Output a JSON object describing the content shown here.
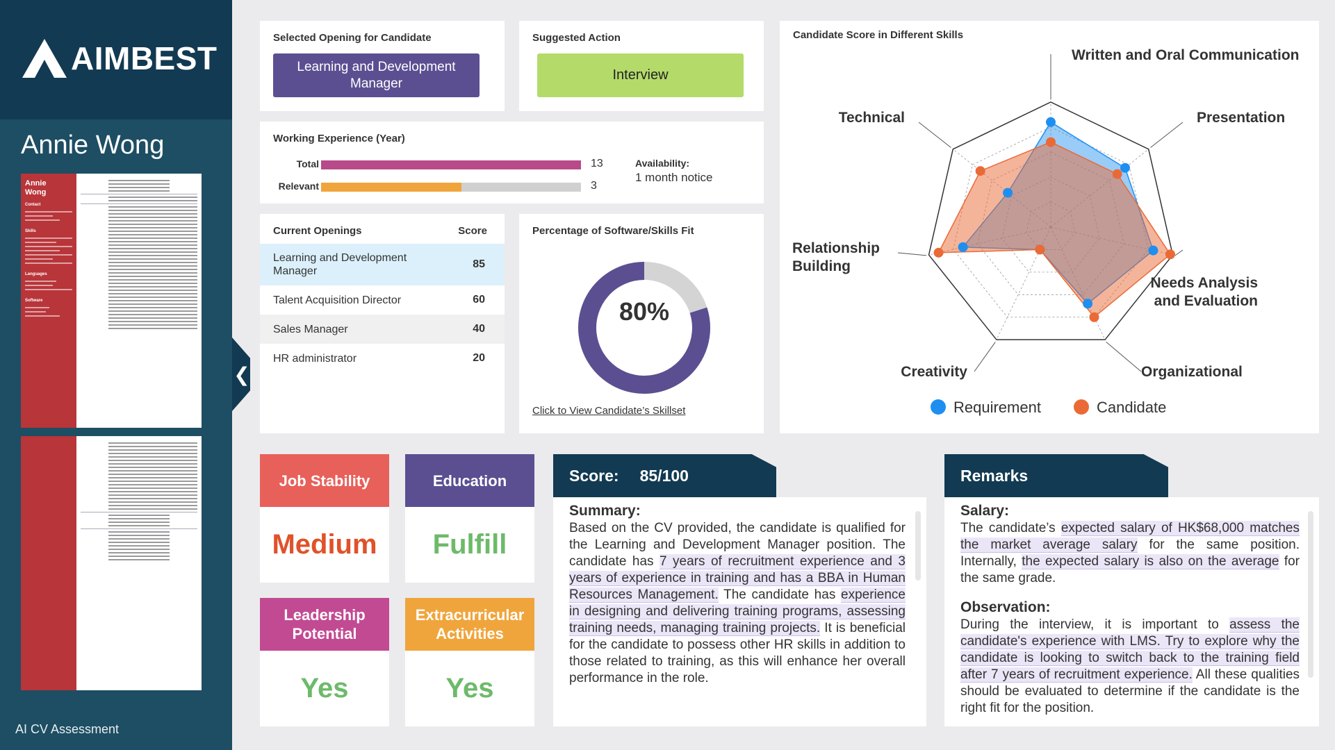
{
  "app": {
    "logo_text": "AIMBEST",
    "candidate_name": "Annie Wong",
    "footer_label": "AI CV Assessment",
    "collapse_glyph": "❮",
    "cv_thumbnail": {
      "name_line1": "Annie",
      "name_line2": "Wong",
      "side_sections": [
        "Contact",
        "Skills",
        "Languages",
        "Software"
      ]
    }
  },
  "selected_opening": {
    "title": "Selected Opening for Candidate",
    "value": "Learning and Development Manager"
  },
  "suggested_action": {
    "title": "Suggested Action",
    "value": "Interview"
  },
  "working_experience": {
    "title": "Working Experience (Year)",
    "rows": [
      {
        "label": "Total",
        "value": "13",
        "fraction": 1.0,
        "color": "#b84a8a"
      },
      {
        "label": "Relevant",
        "value": "3",
        "fraction": 0.54,
        "color": "#f0a53c"
      }
    ],
    "availability_label": "Availability:",
    "availability_value": "1 month notice"
  },
  "current_openings": {
    "title": "Current Openings",
    "score_header": "Score",
    "rows": [
      {
        "name": "Learning and Development Manager",
        "score": "85",
        "selected": true
      },
      {
        "name": "Talent Acquisition Director",
        "score": "60",
        "selected": false
      },
      {
        "name": "Sales Manager",
        "score": "40",
        "selected": false
      },
      {
        "name": "HR administrator",
        "score": "20",
        "selected": false
      }
    ]
  },
  "skills_fit": {
    "title": "Percentage of Software/Skills Fit",
    "percent_label": "80%",
    "fraction": 0.8,
    "fill_color": "#5b4f92",
    "rest_color": "#d4d4d4",
    "link_text": "Click to View Candidate’s Skillset"
  },
  "radar": {
    "title": "Candidate Score in Different Skills",
    "axes": [
      "Written and Oral Communication",
      "Presentation",
      "Needs Analysis and Evaluation",
      "Organizational",
      "Creativity",
      "Relationship Building",
      "Technical"
    ],
    "levels": 5,
    "series": [
      {
        "name": "Requirement",
        "color": "#1e8ff0",
        "values": [
          4.2,
          3.8,
          4.2,
          3.4,
          1.0,
          3.6,
          2.2
        ]
      },
      {
        "name": "Candidate",
        "color": "#ea6a36",
        "values": [
          3.4,
          3.4,
          4.9,
          4.0,
          1.0,
          4.6,
          3.6
        ]
      }
    ],
    "max": 5
  },
  "tiles": [
    {
      "label": "Job Stability",
      "value": "Medium",
      "head_color": "#e8605a",
      "value_color": "#e0522a"
    },
    {
      "label": "Education",
      "value": "Fulfill",
      "head_color": "#5b4f92",
      "value_color": "#6dba6a"
    },
    {
      "label": "Leadership Potential",
      "value": "Yes",
      "head_color": "#c24a93",
      "value_color": "#6dba6a"
    },
    {
      "label": "Extracurricular Activities",
      "value": "Yes",
      "head_color": "#f0a53c",
      "value_color": "#6dba6a"
    }
  ],
  "score_panel": {
    "tab_label": "Score:",
    "tab_value": "85/100",
    "summary_heading": "Summary:",
    "summary_parts": [
      {
        "text": "Based on the CV provided, the candidate is qualified for the Learning and Development Manager position. The candidate has ",
        "mark": false
      },
      {
        "text": "7 years of recruitment experience and 3 years of experience in training and has a BBA in Human Resources Management.",
        "mark": true
      },
      {
        "text": " The candidate has ",
        "mark": false
      },
      {
        "text": "experience in designing and delivering training programs, assessing training needs, managing training projects.",
        "mark": true
      },
      {
        "text": " It is beneficial for the candidate to possess other HR skills in addition to those related to training, as this will enhance her overall performance in the role.",
        "mark": false
      }
    ]
  },
  "remarks_panel": {
    "tab_label": "Remarks",
    "salary_heading": "Salary:",
    "salary_parts": [
      {
        "text": "The candidate’s ",
        "mark": false
      },
      {
        "text": "expected salary of HK$68,000 matches the market average salary",
        "mark": true
      },
      {
        "text": " for the same position. Internally, ",
        "mark": false
      },
      {
        "text": "the expected salary is also on the average",
        "mark": true
      },
      {
        "text": " for the same grade.",
        "mark": false
      }
    ],
    "observation_heading": "Observation:",
    "observation_parts": [
      {
        "text": "During the interview, it is important to ",
        "mark": false
      },
      {
        "text": "assess the candidate's experience with LMS. Try to explore why the candidate is looking to switch back to the training field after 7 years of recruitment experience.",
        "mark": true
      },
      {
        "text": " All these qualities should be evaluated to determine if the candidate is the right fit for the position.",
        "mark": false
      }
    ]
  }
}
